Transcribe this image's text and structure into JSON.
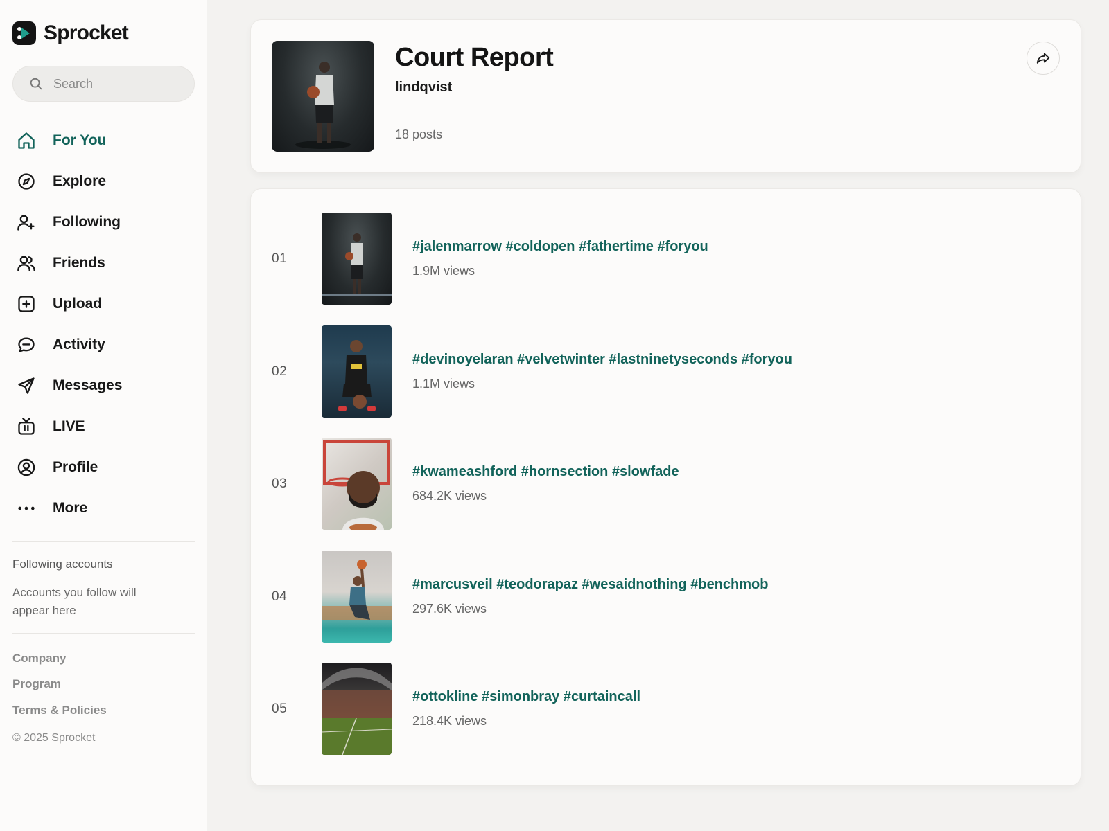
{
  "brand": {
    "name": "Sprocket"
  },
  "search": {
    "placeholder": "Search"
  },
  "nav": [
    {
      "label": "For You",
      "icon": "home-icon",
      "active": true
    },
    {
      "label": "Explore",
      "icon": "compass-icon"
    },
    {
      "label": "Following",
      "icon": "user-plus-icon"
    },
    {
      "label": "Friends",
      "icon": "users-icon"
    },
    {
      "label": "Upload",
      "icon": "plus-square-icon"
    },
    {
      "label": "Activity",
      "icon": "message-circle-icon"
    },
    {
      "label": "Messages",
      "icon": "send-icon"
    },
    {
      "label": "LIVE",
      "icon": "tv-icon"
    },
    {
      "label": "Profile",
      "icon": "user-circle-icon"
    },
    {
      "label": "More",
      "icon": "more-horizontal-icon"
    }
  ],
  "following": {
    "title": "Following accounts",
    "empty": "Accounts you follow will appear here"
  },
  "footer": {
    "links": [
      "Company",
      "Program",
      "Terms & Policies"
    ],
    "copyright": "© 2025 Sprocket"
  },
  "playlist": {
    "title": "Court Report",
    "author": "lindqvist",
    "posts": "18 posts"
  },
  "items": [
    {
      "index": "01",
      "tags": "#jalenmarrow #coldopen #fathertime #foryou",
      "views": "1.9M views"
    },
    {
      "index": "02",
      "tags": "#devinoyelaran #velvetwinter #lastninetyseconds #foryou",
      "views": "1.1M views"
    },
    {
      "index": "03",
      "tags": "#kwameashford #hornsection #slowfade",
      "views": "684.2K views"
    },
    {
      "index": "04",
      "tags": "#marcusveil #teodorapaz #wesaidnothing #benchmob",
      "views": "297.6K views"
    },
    {
      "index": "05",
      "tags": "#ottokline #simonbray #curtaincall",
      "views": "218.4K views"
    }
  ],
  "colors": {
    "accent": "#12635a",
    "text": "#161616",
    "muted": "#666666",
    "background": "#f3f2f0",
    "card": "#fcfbfa"
  }
}
